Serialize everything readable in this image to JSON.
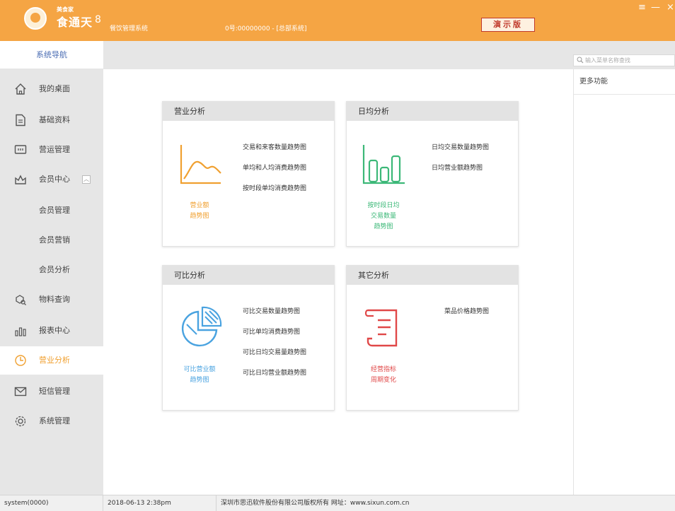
{
  "titlebar": {
    "brand_small": "美食家",
    "brand_name": "食通天",
    "brand_version": "8",
    "system_name": "餐饮管理系统",
    "shop_info": "0号:00000000 - [总部系统]",
    "demo_badge": "演示版",
    "minimize_glyph": "—",
    "skin_glyph": "≡",
    "close_glyph": "×",
    "accent_color": "#f5a544"
  },
  "sidebar": {
    "header": "系统导航",
    "items": [
      {
        "label": "我的桌面",
        "icon": "home-icon"
      },
      {
        "label": "基础资料",
        "icon": "document-icon"
      },
      {
        "label": "营运管理",
        "icon": "screen-icon"
      },
      {
        "label": "会员中心",
        "icon": "crown-icon",
        "expanded": true
      },
      {
        "label": "会员管理"
      },
      {
        "label": "会员营销"
      },
      {
        "label": "会员分析"
      },
      {
        "label": "物料查询",
        "icon": "material-search-icon"
      },
      {
        "label": "报表中心",
        "icon": "report-icon"
      },
      {
        "label": "营业分析",
        "icon": "clock-chart-icon",
        "active": true
      },
      {
        "label": "短信管理",
        "icon": "mail-icon"
      },
      {
        "label": "系统管理",
        "icon": "gear-icon"
      }
    ],
    "active_color": "#f0a030"
  },
  "search": {
    "placeholder": "输入菜单名称查找"
  },
  "right_panel": {
    "title": "更多功能"
  },
  "cards": [
    {
      "title": "营业分析",
      "icon": "line-chart-icon",
      "caption_lines": [
        "营业额",
        "趋势图"
      ],
      "color": "#f0a030",
      "links": [
        "交易和来客数量趋势图",
        "单均和人均消费趋势图",
        "按时段单均消费趋势图"
      ]
    },
    {
      "title": "日均分析",
      "icon": "bar-chart-icon",
      "caption_lines": [
        "按时段日均",
        "交易数量",
        "趋势图"
      ],
      "color": "#3cb878",
      "links": [
        "日均交易数量趋势图",
        "日均营业额趋势图"
      ]
    },
    {
      "title": "可比分析",
      "icon": "pie-chart-icon",
      "caption_lines": [
        "可比营业额",
        "趋势图"
      ],
      "color": "#4aa3e0",
      "links": [
        "可比交易数量趋势图",
        "可比单均消费趋势图",
        "可比日均交易量趋势图",
        "可比日均营业额趋势图"
      ]
    },
    {
      "title": "其它分析",
      "icon": "scroll-doc-icon",
      "caption_lines": [
        "经营指标",
        "周期变化"
      ],
      "color": "#e04848",
      "links": [
        "菜品价格趋势图"
      ]
    }
  ],
  "statusbar": {
    "user": "system(0000)",
    "datetime": "2018-06-13 2:38pm",
    "copyright": "深圳市思迅软件股份有限公司版权所有 网址：www.sixun.com.cn"
  }
}
